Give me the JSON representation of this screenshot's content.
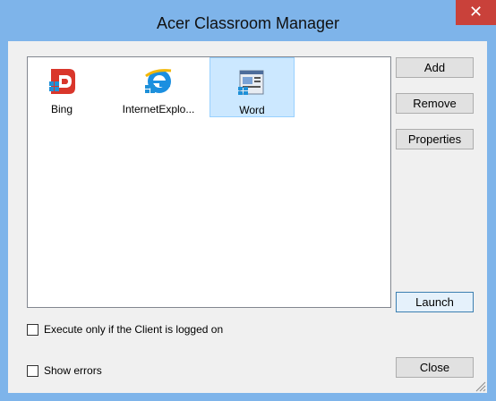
{
  "window": {
    "title": "Acer Classroom Manager",
    "close_glyph": "✕"
  },
  "apps": [
    {
      "label": "Bing",
      "icon": "bing-icon"
    },
    {
      "label": "InternetExplo...",
      "icon": "internet-explorer-icon"
    },
    {
      "label": "Word",
      "icon": "word-icon",
      "selected": true
    }
  ],
  "buttons": {
    "add": "Add",
    "remove": "Remove",
    "properties": "Properties",
    "launch": "Launch",
    "close": "Close"
  },
  "options": {
    "execute_logged_on": {
      "label": "Execute only if the Client is logged on",
      "checked": false
    },
    "show_errors": {
      "label": "Show errors",
      "checked": false
    }
  },
  "colors": {
    "frame": "#7eb4ea",
    "close": "#c9413a",
    "selection": "#cce8ff"
  }
}
